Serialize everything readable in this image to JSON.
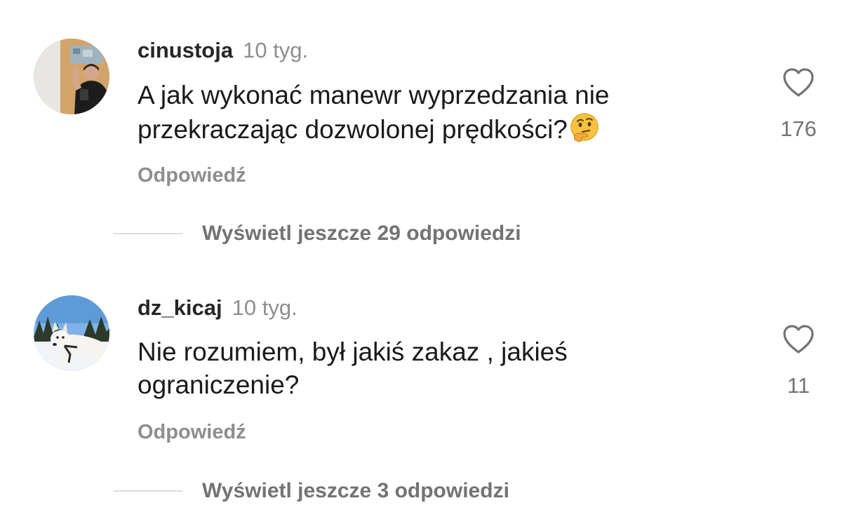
{
  "comments": [
    {
      "username": "cinustoja",
      "time": "10 tyg.",
      "text_line1": "A jak wykonać manewr  wyprzedzania nie",
      "text_line2": "przekraczając dozwolonej prędkości?",
      "emoji_icon": "thinking-face-icon",
      "reply_label": "Odpowiedź",
      "like_count": "176",
      "view_more": "Wyświetl jeszcze 29 odpowiedzi"
    },
    {
      "username": "dz_kicaj",
      "time": "10 tyg.",
      "text_line1": "Nie rozumiem, był jakiś zakaz , jakieś",
      "text_line2": "ograniczenie?",
      "reply_label": "Odpowiedź",
      "like_count": "11",
      "view_more": "Wyświetl jeszcze 3 odpowiedzi"
    }
  ],
  "colors": {
    "secondary_text": "#8e8e8e",
    "divider": "#dbdbdb",
    "primary_text": "#1a1a1a"
  }
}
